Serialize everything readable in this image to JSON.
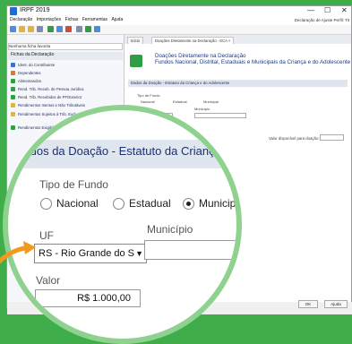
{
  "window": {
    "title": "IRPF 2019",
    "controls": [
      "—",
      "☐",
      "✕"
    ]
  },
  "menu": {
    "items": [
      "Declaração",
      "Importações",
      "Fichas",
      "Ferramentas",
      "Ajuda"
    ],
    "right_links": "Declaração de Ajuste   Perfil: Tit"
  },
  "sidebar": {
    "ficha_selector": "Nenhuma ficha favorita",
    "fichas_header": "Fichas da Declaração",
    "items": [
      {
        "label": "Ident. do Contribuinte",
        "color": "#3b6fd0"
      },
      {
        "label": "Dependentes",
        "color": "#d07a3b"
      },
      {
        "label": "Alimentandos",
        "color": "#2f9e44"
      },
      {
        "label": "Rend. Trib. Receb. de Pessoa Jurídica",
        "color": "#2f9e44"
      },
      {
        "label": "Rend. Trib. Recebidos de PF/Exterior",
        "color": "#2f9e44"
      },
      {
        "label": "Rendimentos Isentos e Não Tributáveis",
        "color": "#e0b53b"
      },
      {
        "label": "Rendimentos Sujeitos à Trib. Exclusiva/Definitiva",
        "color": "#e0b53b"
      },
      {
        "label": "Rendimentos Exigibilidade",
        "color": "#2f9e44"
      }
    ]
  },
  "tabs": [
    "Início",
    "Doações Diretamente na Declaração - ECA ×"
  ],
  "banner": {
    "line1": "Doações Diretamente na Declaração",
    "line2": "Fundos Nacional, Distrital, Estaduais e Municipais da Criança e do Adolescente"
  },
  "form_small": {
    "section": "Dados da Doação - Estatuto da Criança e do Adolescente",
    "tipo_label": "Tipo de Fundo",
    "options": [
      "Nacional",
      "Estadual",
      "Municipal"
    ],
    "uf_label": "UF",
    "municipio_label": "Município",
    "uf_value": "RS - Rio Grande do S"
  },
  "zoom": {
    "section_title": "Dados da Doação - Estatuto da Criança e do A",
    "tipo_label": "Tipo de Fundo",
    "options": [
      "Nacional",
      "Estadual",
      "Municipal"
    ],
    "selected_option": "Municipal",
    "uf_label": "UF",
    "uf_value": "RS - Rio Grande do S",
    "municipio_label": "Município",
    "valor_label": "Valor",
    "valor_value": "R$ 1.000,00"
  },
  "valor_disponivel_label": "Valor disponível para doação:",
  "buttons": {
    "ok": "OK",
    "help": "Ajuda"
  },
  "colors": {
    "accent_green": "#3fae4a",
    "header_blue": "#1b3a8a",
    "zoom_ring": "#8fd18f",
    "arrow": "#f39a1b"
  }
}
